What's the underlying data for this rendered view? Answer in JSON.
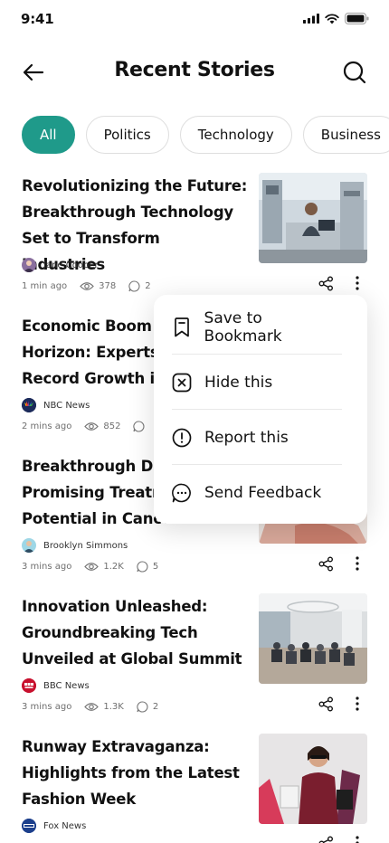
{
  "status_bar": {
    "time": "9:41"
  },
  "header": {
    "title": "Recent Stories",
    "back_icon": "arrow-left-icon",
    "search_icon": "search-icon"
  },
  "categories": [
    {
      "label": "All",
      "active": true
    },
    {
      "label": "Politics",
      "active": false
    },
    {
      "label": "Technology",
      "active": false
    },
    {
      "label": "Business",
      "active": false
    }
  ],
  "stories": [
    {
      "title": "Revolutionizing the Future: Breakthrough Technology Set to Transform Industries",
      "author": "Jane Cooper",
      "time": "1 min ago",
      "views": "378",
      "comments": "2"
    },
    {
      "title": "Economic Boom on the Horizon: Experts Predict Record Growth in",
      "author": "NBC News",
      "time": "2 mins ago",
      "views": "852",
      "comments": ""
    },
    {
      "title": "Breakthrough Discovery: Promising Treatment Potential in Cancer",
      "author": "Brooklyn Simmons",
      "time": "3 mins ago",
      "views": "1.2K",
      "comments": "5"
    },
    {
      "title": "Innovation Unleashed: Groundbreaking Tech Unveiled at Global Summit",
      "author": "BBC News",
      "time": "3 mins ago",
      "views": "1.3K",
      "comments": "2"
    },
    {
      "title": "Runway Extravaganza: Highlights from the Latest Fashion Week",
      "author": "Fox News",
      "time": "",
      "views": "",
      "comments": ""
    }
  ],
  "context_menu": {
    "items": [
      {
        "label": "Save to Bookmark",
        "icon": "bookmark-icon"
      },
      {
        "label": "Hide this",
        "icon": "hide-icon"
      },
      {
        "label": "Report this",
        "icon": "report-icon"
      },
      {
        "label": "Send Feedback",
        "icon": "feedback-icon"
      }
    ]
  },
  "colors": {
    "accent": "#1f9a8a",
    "text": "#111111",
    "muted": "#6f6f6f"
  }
}
